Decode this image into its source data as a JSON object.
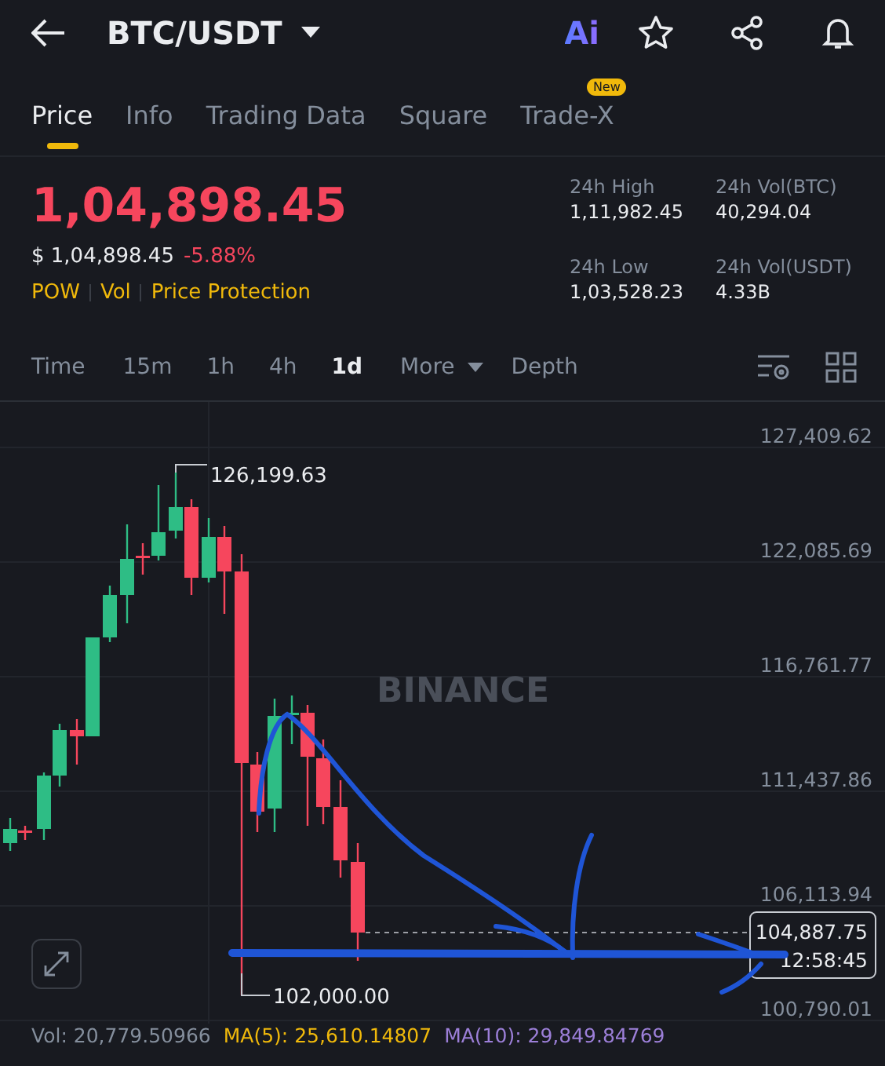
{
  "header": {
    "title": "BTC/USDT",
    "ai_label": "Ai"
  },
  "tabs": [
    {
      "label": "Price",
      "selected": true
    },
    {
      "label": "Info",
      "selected": false
    },
    {
      "label": "Trading Data",
      "selected": false
    },
    {
      "label": "Square",
      "selected": false
    },
    {
      "label": "Trade-X",
      "selected": false,
      "badge": "New"
    }
  ],
  "price": {
    "last": "1,04,898.45",
    "fiat": "$ 1,04,898.45",
    "change": "-5.88%",
    "tags": [
      "POW",
      "Vol",
      "Price Protection"
    ]
  },
  "stats": [
    {
      "label": "24h High",
      "value": "1,11,982.45"
    },
    {
      "label": "24h Vol(BTC)",
      "value": "40,294.04"
    },
    {
      "label": "24h Low",
      "value": "1,03,528.23"
    },
    {
      "label": "24h Vol(USDT)",
      "value": "4.33B"
    }
  ],
  "intervals": [
    {
      "label": "Time",
      "selected": false,
      "kind": "plain"
    },
    {
      "label": "15m",
      "selected": false,
      "kind": "plain"
    },
    {
      "label": "1h",
      "selected": false,
      "kind": "plain"
    },
    {
      "label": "4h",
      "selected": false,
      "kind": "plain"
    },
    {
      "label": "1d",
      "selected": true,
      "kind": "plain"
    },
    {
      "label": "More",
      "selected": false,
      "kind": "dropdown"
    },
    {
      "label": "Depth",
      "selected": false,
      "kind": "plain"
    }
  ],
  "chart": {
    "watermark": "BINANCE",
    "y_labels": [
      "127,409.62",
      "122,085.69",
      "116,761.77",
      "111,437.86",
      "106,113.94",
      "100,790.01"
    ],
    "high_marker": "126,199.63",
    "low_marker": "102,000.00",
    "current_price": "104,887.75",
    "countdown": "12:58:45"
  },
  "indicators": [
    {
      "label": "Vol: 20,779.50966",
      "color": "#848e9c"
    },
    {
      "label": "MA(5): 25,610.14807",
      "color": "#f0b90b"
    },
    {
      "label": "MA(10): 29,849.84769",
      "color": "#9c7fd8"
    }
  ]
}
